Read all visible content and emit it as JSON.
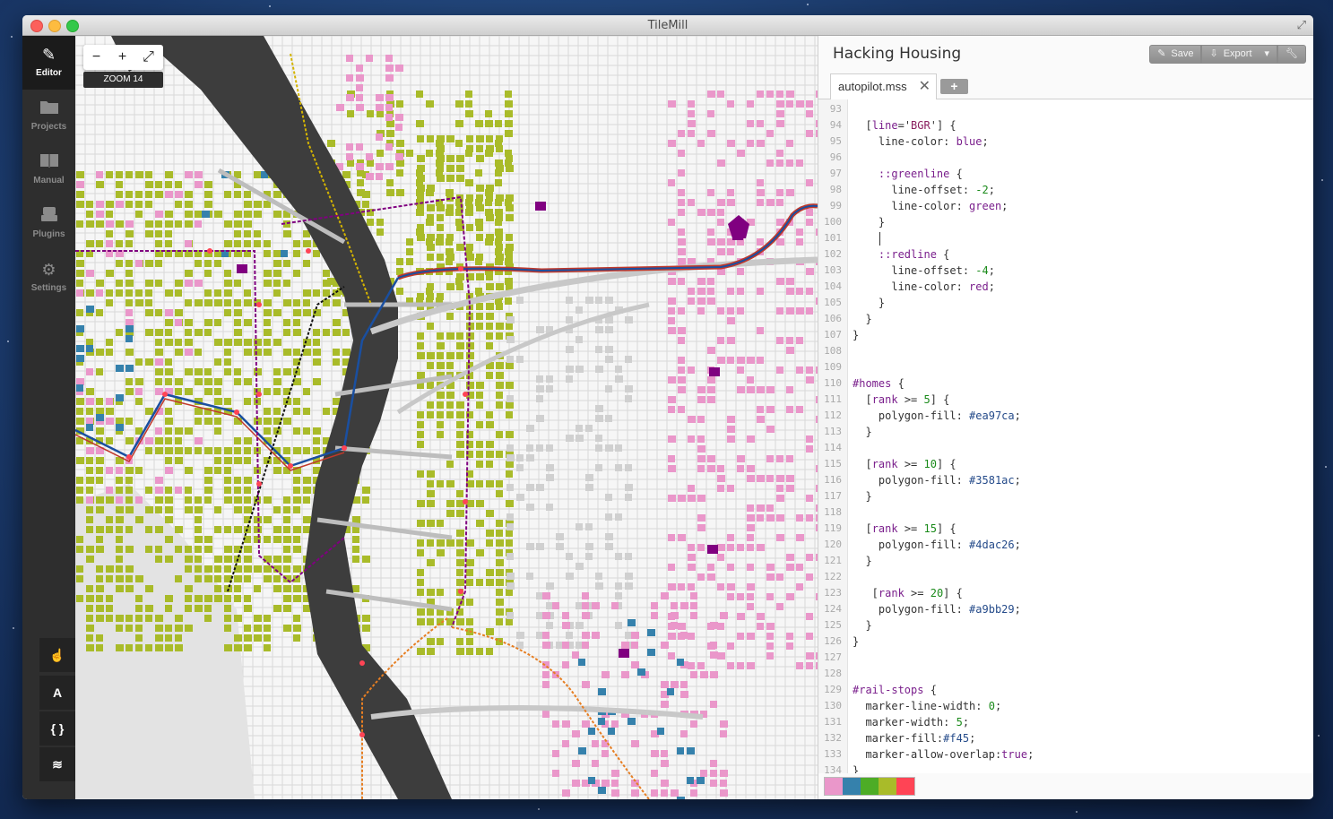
{
  "window": {
    "title": "TileMill"
  },
  "sidebar": {
    "items": [
      {
        "label": "Editor",
        "icon": "pencil-icon",
        "active": true
      },
      {
        "label": "Projects",
        "icon": "folder-icon",
        "active": false
      },
      {
        "label": "Manual",
        "icon": "book-icon",
        "active": false
      },
      {
        "label": "Plugins",
        "icon": "plugins-icon",
        "active": false
      },
      {
        "label": "Settings",
        "icon": "gear-icon",
        "active": false
      }
    ],
    "tools": [
      {
        "name": "pan-tool",
        "glyph": "☝"
      },
      {
        "name": "text-tool",
        "glyph": "A"
      },
      {
        "name": "code-tool",
        "glyph": "{ }"
      },
      {
        "name": "layers-tool",
        "glyph": "≋"
      }
    ]
  },
  "map": {
    "zoom_out": "−",
    "zoom_in": "+",
    "fullscreen": "⤢",
    "zoom_label": "ZOOM 14"
  },
  "editor": {
    "project_title": "Hacking Housing",
    "toolbar": {
      "save": "Save",
      "export": "Export"
    },
    "tab": {
      "name": "autopilot.mss",
      "close": "✕",
      "add": "+"
    },
    "lines": [
      {
        "n": "93",
        "t": ""
      },
      {
        "n": "94",
        "t": "  [line='BGR'] {"
      },
      {
        "n": "95",
        "t": "    line-color: blue;"
      },
      {
        "n": "96",
        "t": ""
      },
      {
        "n": "97",
        "t": "    ::greenline {"
      },
      {
        "n": "98",
        "t": "      line-offset: -2;"
      },
      {
        "n": "99",
        "t": "      line-color: green;"
      },
      {
        "n": "100",
        "t": "    }"
      },
      {
        "n": "101",
        "t": ""
      },
      {
        "n": "102",
        "t": "    ::redline {"
      },
      {
        "n": "103",
        "t": "      line-offset: -4;"
      },
      {
        "n": "104",
        "t": "      line-color: red;"
      },
      {
        "n": "105",
        "t": "    }"
      },
      {
        "n": "106",
        "t": "  }"
      },
      {
        "n": "107",
        "t": "}"
      },
      {
        "n": "108",
        "t": ""
      },
      {
        "n": "109",
        "t": ""
      },
      {
        "n": "110",
        "t": "#homes {"
      },
      {
        "n": "111",
        "t": "  [rank >= 5] {"
      },
      {
        "n": "112",
        "t": "    polygon-fill: #ea97ca;"
      },
      {
        "n": "113",
        "t": "  }"
      },
      {
        "n": "114",
        "t": ""
      },
      {
        "n": "115",
        "t": "  [rank >= 10] {"
      },
      {
        "n": "116",
        "t": "    polygon-fill: #3581ac;"
      },
      {
        "n": "117",
        "t": "  }"
      },
      {
        "n": "118",
        "t": ""
      },
      {
        "n": "119",
        "t": "  [rank >= 15] {"
      },
      {
        "n": "120",
        "t": "    polygon-fill: #4dac26;"
      },
      {
        "n": "121",
        "t": "  }"
      },
      {
        "n": "122",
        "t": ""
      },
      {
        "n": "123",
        "t": "   [rank >= 20] {"
      },
      {
        "n": "124",
        "t": "    polygon-fill: #a9bb29;"
      },
      {
        "n": "125",
        "t": "  }"
      },
      {
        "n": "126",
        "t": "}"
      },
      {
        "n": "127",
        "t": ""
      },
      {
        "n": "128",
        "t": ""
      },
      {
        "n": "129",
        "t": "#rail-stops {"
      },
      {
        "n": "130",
        "t": "  marker-line-width: 0;"
      },
      {
        "n": "131",
        "t": "  marker-width: 5;"
      },
      {
        "n": "132",
        "t": "  marker-fill:#f45;"
      },
      {
        "n": "133",
        "t": "  marker-allow-overlap:true;"
      },
      {
        "n": "134",
        "t": "}"
      }
    ],
    "swatches": [
      "#ea97ca",
      "#3581ac",
      "#4dac26",
      "#a9bb29",
      "#ff4455"
    ]
  },
  "colors": {
    "homes_pink": "#ea97ca",
    "homes_blue": "#3581ac",
    "homes_green": "#4dac26",
    "homes_olive": "#a9bb29",
    "river": "#3d3d3d",
    "purple": "#800080"
  }
}
